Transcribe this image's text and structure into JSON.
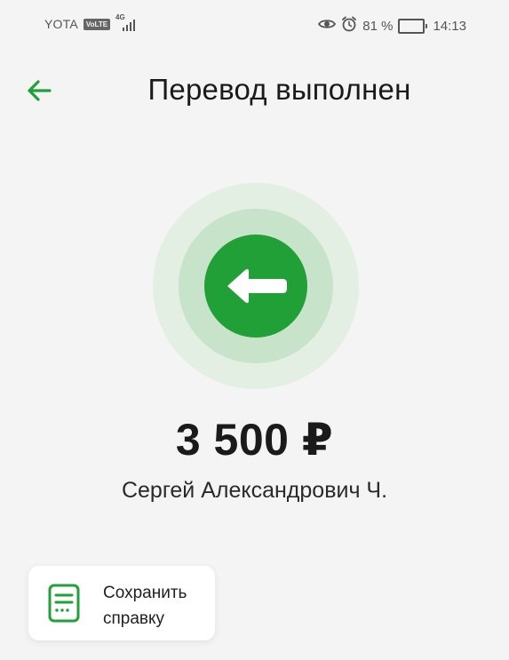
{
  "status_bar": {
    "carrier": "YOTA",
    "volte": "VoLTE",
    "network": "4G",
    "battery": "81 %",
    "time": "14:13",
    "icons": [
      "eye-icon",
      "alarm-icon",
      "battery-icon",
      "signal-icon"
    ]
  },
  "header": {
    "title": "Перевод выполнен",
    "back_icon": "arrow-left-icon"
  },
  "status_icon": "arrow-left-icon",
  "transfer": {
    "amount": "3 500 ₽",
    "recipient": "Сергей Александрович Ч."
  },
  "actions": {
    "save_receipt_label": "Сохранить справку",
    "save_receipt_icon": "receipt-icon"
  },
  "colors": {
    "accent": "#21a038",
    "ring_mid": "#c7e3c9",
    "ring_outer": "#e3efe3",
    "background": "#f4f4f4"
  },
  "battery_level": 0.81
}
